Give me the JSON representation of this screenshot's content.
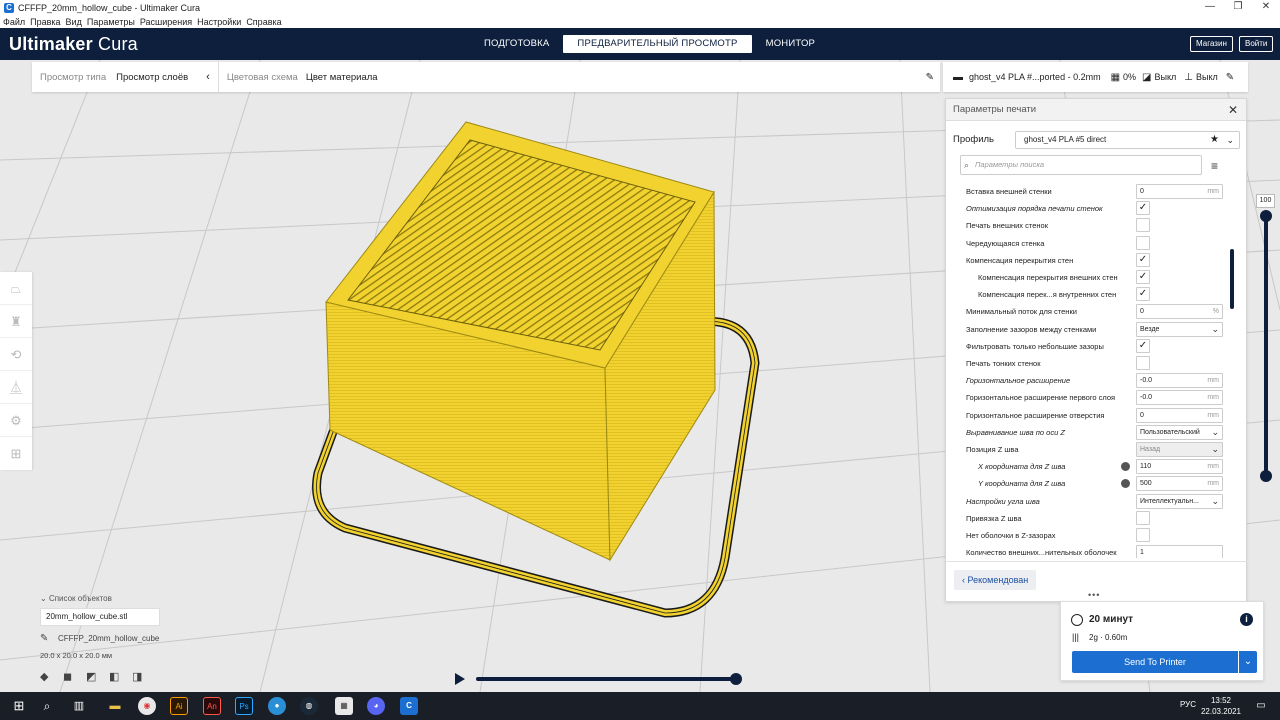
{
  "window": {
    "title": "CFFFP_20mm_hollow_cube - Ultimaker Cura",
    "controls": [
      "—",
      "❐",
      "✕"
    ]
  },
  "menu": [
    "Файл",
    "Правка",
    "Вид",
    "Параметры",
    "Расширения",
    "Настройки",
    "Справка"
  ],
  "header": {
    "logo_main": "Ultimaker",
    "logo_sub": "Cura",
    "stages": [
      "ПОДГОТОВКА",
      "ПРЕДВАРИТЕЛЬНЫЙ ПРОСМОТР",
      "МОНИТОР"
    ],
    "active_stage": 1,
    "marketplace": "Магазин",
    "signin": "Войти"
  },
  "viewbar": {
    "view_type_label": "Просмотр типа",
    "view_type_value": "Просмотр слоёв",
    "color_scheme_label": "Цветовая схема",
    "color_scheme_value": "Цвет материала"
  },
  "setup": {
    "profile_summary": "ghost_v4 PLA #...ported - 0.2mm",
    "infill": "0%",
    "support": "Выкл",
    "adhesion": "Выкл"
  },
  "panel": {
    "title": "Параметры печати",
    "profile_label": "Профиль",
    "profile_value": "ghost_v4 PLA #5 direct",
    "search_placeholder": "Параметры поиска",
    "recommended": "Рекомендован",
    "settings": [
      {
        "label": "Вставка внешней стенки",
        "type": "input",
        "value": "0",
        "unit": "mm"
      },
      {
        "label": "Оптимизация порядка печати стенок",
        "type": "check",
        "checked": true,
        "italic": true
      },
      {
        "label": "Печать внешних стенок",
        "type": "check",
        "checked": false
      },
      {
        "label": "Чередующаяся стенка",
        "type": "check",
        "checked": false
      },
      {
        "label": "Компенсация перекрытия стен",
        "type": "check",
        "checked": true
      },
      {
        "label": "Компенсация перекрытия внешних стен",
        "type": "check",
        "checked": true,
        "indent": true
      },
      {
        "label": "Компенсация перек...я внутренних стен",
        "type": "check",
        "checked": true,
        "indent": true
      },
      {
        "label": "Минимальный поток для стенки",
        "type": "input",
        "value": "0",
        "unit": "%"
      },
      {
        "label": "Заполнение зазоров между стенками",
        "type": "dropdown",
        "value": "Везде"
      },
      {
        "label": "Фильтровать только небольшие зазоры",
        "type": "check",
        "checked": true
      },
      {
        "label": "Печать тонких стенок",
        "type": "check",
        "checked": false
      },
      {
        "label": "Горизонтальное расширение",
        "type": "input",
        "value": "-0.0",
        "unit": "mm",
        "italic": true
      },
      {
        "label": "Горизонтальное расширение первого слоя",
        "type": "input",
        "value": "-0.0",
        "unit": "mm"
      },
      {
        "label": "Горизонтальное расширение отверстия",
        "type": "input",
        "value": "0",
        "unit": "mm"
      },
      {
        "label": "Выравнивание шва по оси Z",
        "type": "dropdown",
        "value": "Пользовательский",
        "italic": true
      },
      {
        "label": "Позиция Z шва",
        "type": "dropdown",
        "value": "Назад",
        "grey": true
      },
      {
        "label": "X координата для Z шва",
        "type": "input",
        "value": "110",
        "unit": "mm",
        "indent": true,
        "italic": true,
        "link": true
      },
      {
        "label": "Y координата для Z шва",
        "type": "input",
        "value": "500",
        "unit": "mm",
        "indent": true,
        "italic": true,
        "link": true
      },
      {
        "label": "Настройки угла шва",
        "type": "dropdown",
        "value": "Интеллектуальн...",
        "italic": true
      },
      {
        "label": "Привязка Z шва",
        "type": "check",
        "checked": false
      },
      {
        "label": "Нет оболочки в Z-зазорах",
        "type": "check",
        "checked": false
      },
      {
        "label": "Количество внешних...нительных оболочек",
        "type": "input",
        "value": "1",
        "unit": ""
      }
    ]
  },
  "layer_slider": {
    "value": "100"
  },
  "objects": {
    "header": "Список объектов",
    "file": "20mm_hollow_cube.stl",
    "object_name": "CFFFP_20mm_hollow_cube",
    "dimensions": "20.0 x 20.0 x 20.0 мм"
  },
  "summary": {
    "time": "20 минут",
    "material": "2g · 0.60m",
    "send": "Send To Printer"
  },
  "taskbar": {
    "apps": [
      "Ai",
      "An",
      "Ps"
    ],
    "lang": "РУС",
    "time": "13:52",
    "date": "22.03.2021"
  },
  "colors": {
    "header_bg": "#0d1f3c",
    "accent": "#1c6fd1",
    "model_yellow": "#f2d22e"
  }
}
